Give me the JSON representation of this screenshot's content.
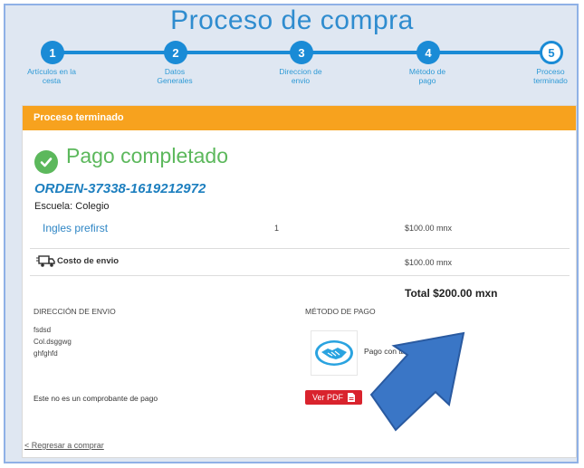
{
  "page": {
    "title": "Proceso de compra"
  },
  "steps": [
    {
      "number": "1",
      "label_line1": "Artículos en la",
      "label_line2": "cesta"
    },
    {
      "number": "2",
      "label_line1": "Datos",
      "label_line2": "Generales"
    },
    {
      "number": "3",
      "label_line1": "Direccion de",
      "label_line2": "envio"
    },
    {
      "number": "4",
      "label_line1": "Método de",
      "label_line2": "pago"
    },
    {
      "number": "5",
      "label_line1": "Proceso",
      "label_line2": "terminado"
    }
  ],
  "card": {
    "header": "Proceso terminado",
    "success_title": "Pago completado",
    "order_id": "ORDEN-37338-1619212972",
    "school": "Escuela: Colegio",
    "item": {
      "name": "Ingles prefirst",
      "qty": "1",
      "price": "$100.00 mnx"
    },
    "shipping": {
      "label": "Costo de envio",
      "price": "$100.00 mnx"
    },
    "total": "Total $200.00 mxn",
    "address": {
      "heading": "DIRECCIÓN DE ENVIO",
      "lines": [
        "fsdsd",
        "Col.dsggwg",
        "ghfghfd"
      ]
    },
    "payment": {
      "heading": "MÉTODO DE PAGO",
      "method": "Pago con tarjeta"
    },
    "disclaimer": "Este no es un comprobante de pago",
    "pdf_button": "Ver PDF",
    "back_link": "< Regresar a comprar"
  },
  "icons": {
    "success": "check-circle-icon",
    "shipping": "truck-icon",
    "payment": "handshake-icon",
    "pdf": "file-pdf-icon"
  },
  "colors": {
    "accent_blue": "#1a8bd6",
    "header_orange": "#f7a21e",
    "success_green": "#5cb85c",
    "pdf_red": "#d9232d",
    "annotation_arrow": "#3a76c6"
  }
}
